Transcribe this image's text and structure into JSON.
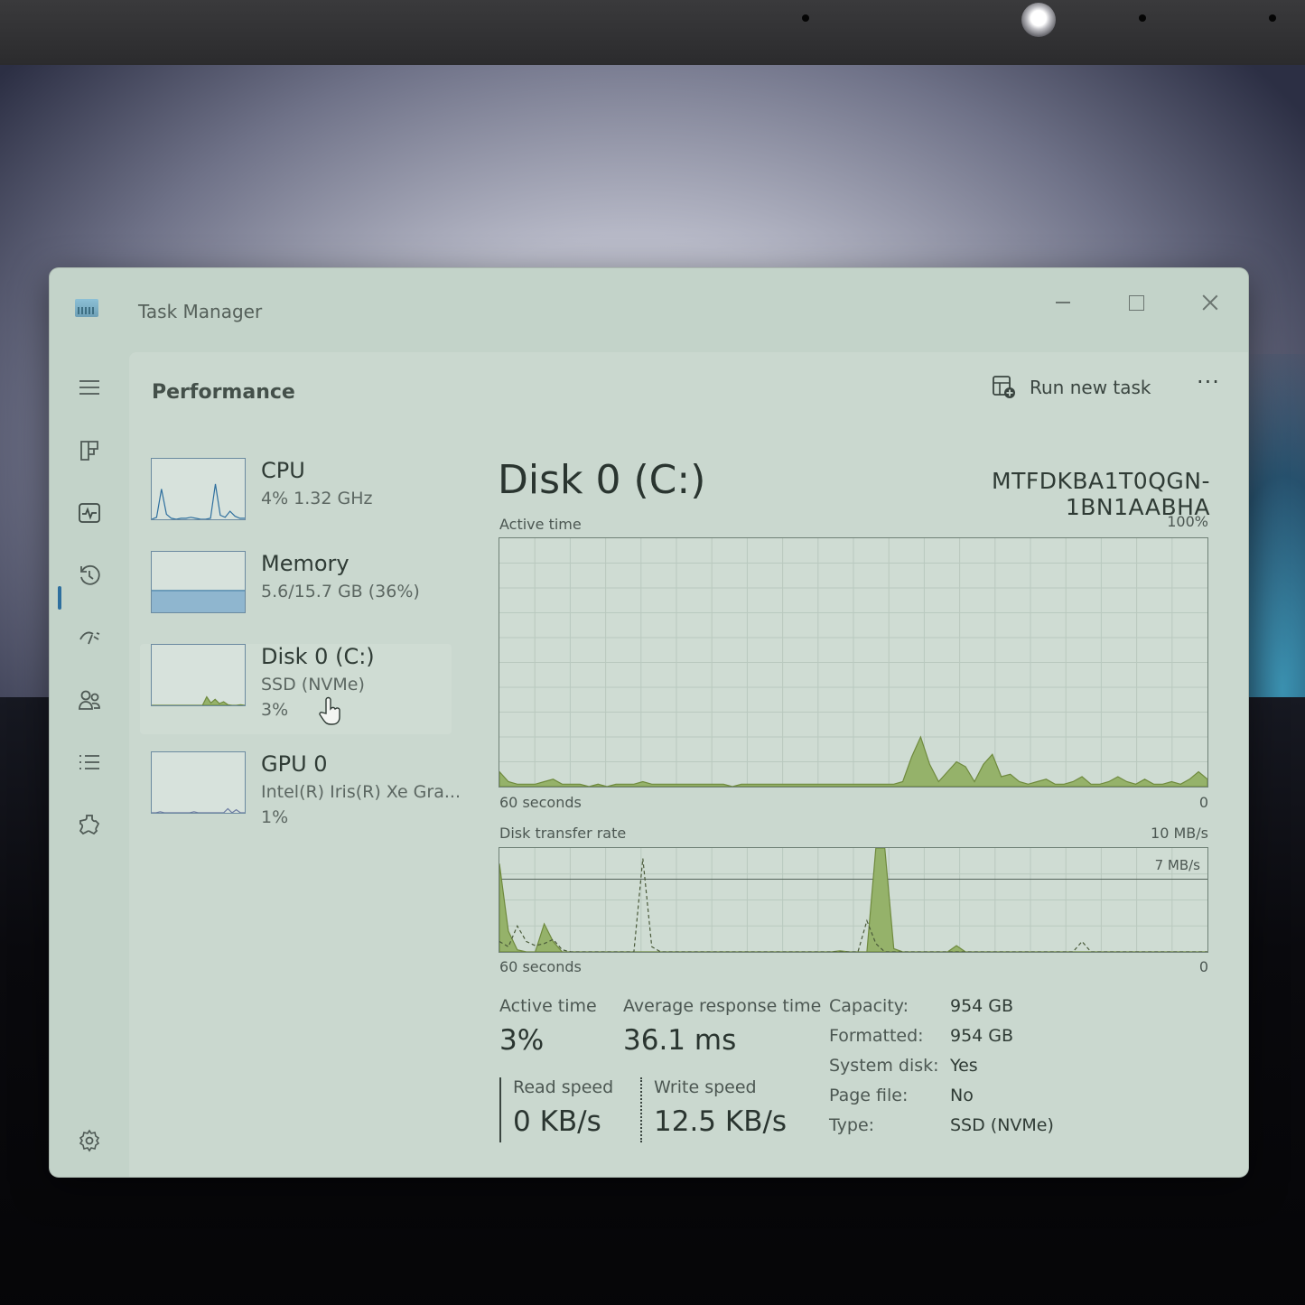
{
  "window": {
    "title": "Task Manager"
  },
  "nav": {
    "items": [
      {
        "icon": "hamburger-menu-icon"
      },
      {
        "icon": "processes-icon"
      },
      {
        "icon": "performance-icon",
        "active": true
      },
      {
        "icon": "app-history-icon"
      },
      {
        "icon": "startup-apps-icon"
      },
      {
        "icon": "users-icon"
      },
      {
        "icon": "details-icon"
      },
      {
        "icon": "services-icon"
      },
      {
        "icon": "settings-icon"
      }
    ]
  },
  "header": {
    "page_title": "Performance",
    "run_new_task": "Run new task",
    "more": "···"
  },
  "devices": [
    {
      "name": "CPU",
      "sub": "4%  1.32 GHz",
      "sub2": ""
    },
    {
      "name": "Memory",
      "sub": "5.6/15.7 GB (36%)",
      "sub2": ""
    },
    {
      "name": "Disk 0 (C:)",
      "sub": "SSD (NVMe)",
      "sub2": "3%"
    },
    {
      "name": "GPU 0",
      "sub": "Intel(R) Iris(R) Xe Gra...",
      "sub2": "1%"
    }
  ],
  "detail": {
    "title": "Disk 0 (C:)",
    "model": "MTFDKBA1T0QGN-1BN1AABHA",
    "active_graph": {
      "label": "Active time",
      "max": "100%",
      "time_span": "60 seconds",
      "min": "0",
      "values_percent": [
        6,
        2,
        1,
        1,
        1,
        2,
        3,
        1,
        1,
        1,
        0,
        1,
        0,
        1,
        1,
        1,
        2,
        1,
        1,
        1,
        1,
        1,
        1,
        1,
        1,
        1,
        0,
        1,
        1,
        1,
        1,
        1,
        1,
        1,
        1,
        1,
        1,
        1,
        1,
        1,
        1,
        1,
        1,
        1,
        1,
        2,
        12,
        20,
        9,
        2,
        6,
        10,
        8,
        2,
        9,
        13,
        4,
        5,
        2,
        1,
        2,
        3,
        1,
        1,
        2,
        4,
        1,
        1,
        2,
        4,
        2,
        1,
        3,
        1,
        1,
        2,
        1,
        3,
        6,
        3
      ]
    },
    "transfer_graph": {
      "label": "Disk transfer rate",
      "max": "10 MB/s",
      "marker": "7 MB/s",
      "time_span": "60 seconds",
      "min": "0",
      "read_mb_s": [
        8.5,
        2,
        0.2,
        0,
        0,
        2.7,
        1,
        0,
        0,
        0,
        0,
        0,
        0,
        0,
        0,
        0,
        0,
        0,
        0,
        0,
        0,
        0,
        0,
        0,
        0,
        0,
        0,
        0,
        0,
        0,
        0,
        0,
        0,
        0,
        0,
        0,
        0,
        0,
        0.1,
        0,
        0,
        0,
        10,
        10,
        0.3,
        0,
        0,
        0,
        0,
        0,
        0,
        0.6,
        0,
        0,
        0,
        0,
        0,
        0,
        0,
        0,
        0,
        0,
        0,
        0,
        0,
        0,
        0,
        0,
        0,
        0,
        0,
        0,
        0,
        0,
        0,
        0,
        0,
        0,
        0,
        0
      ],
      "write_mb_s": [
        1,
        0.5,
        2.5,
        1,
        0.6,
        0.8,
        1.2,
        0.2,
        0,
        0,
        0,
        0,
        0,
        0,
        0,
        0,
        9,
        0.5,
        0,
        0,
        0,
        0,
        0,
        0,
        0,
        0,
        0,
        0,
        0,
        0,
        0,
        0,
        0,
        0,
        0,
        0,
        0,
        0,
        0,
        0,
        0,
        3,
        0.8,
        0,
        0,
        0,
        0,
        0,
        0,
        0,
        0,
        0,
        0,
        0,
        0,
        0,
        0,
        0,
        0,
        0,
        0,
        0,
        0,
        0,
        0,
        1,
        0,
        0,
        0,
        0,
        0,
        0,
        0,
        0,
        0,
        0,
        0,
        0,
        0,
        0
      ]
    },
    "stats": {
      "active_time_label": "Active time",
      "active_time_value": "3%",
      "avg_response_label": "Average response time",
      "avg_response_value": "36.1 ms",
      "read_speed_label": "Read speed",
      "read_speed_value": "0 KB/s",
      "write_speed_label": "Write speed",
      "write_speed_value": "12.5 KB/s"
    },
    "properties": [
      {
        "key": "Capacity:",
        "value": "954 GB"
      },
      {
        "key": "Formatted:",
        "value": "954 GB"
      },
      {
        "key": "System disk:",
        "value": "Yes"
      },
      {
        "key": "Page file:",
        "value": "No"
      },
      {
        "key": "Type:",
        "value": "SSD (NVMe)"
      }
    ]
  },
  "colors": {
    "disk_fill": "#95b26a",
    "disk_line": "#6f8a3e",
    "cpu_line": "#2e6f9e",
    "memory_fill": "#8fb6cf",
    "grid": "#b9c9bf"
  }
}
